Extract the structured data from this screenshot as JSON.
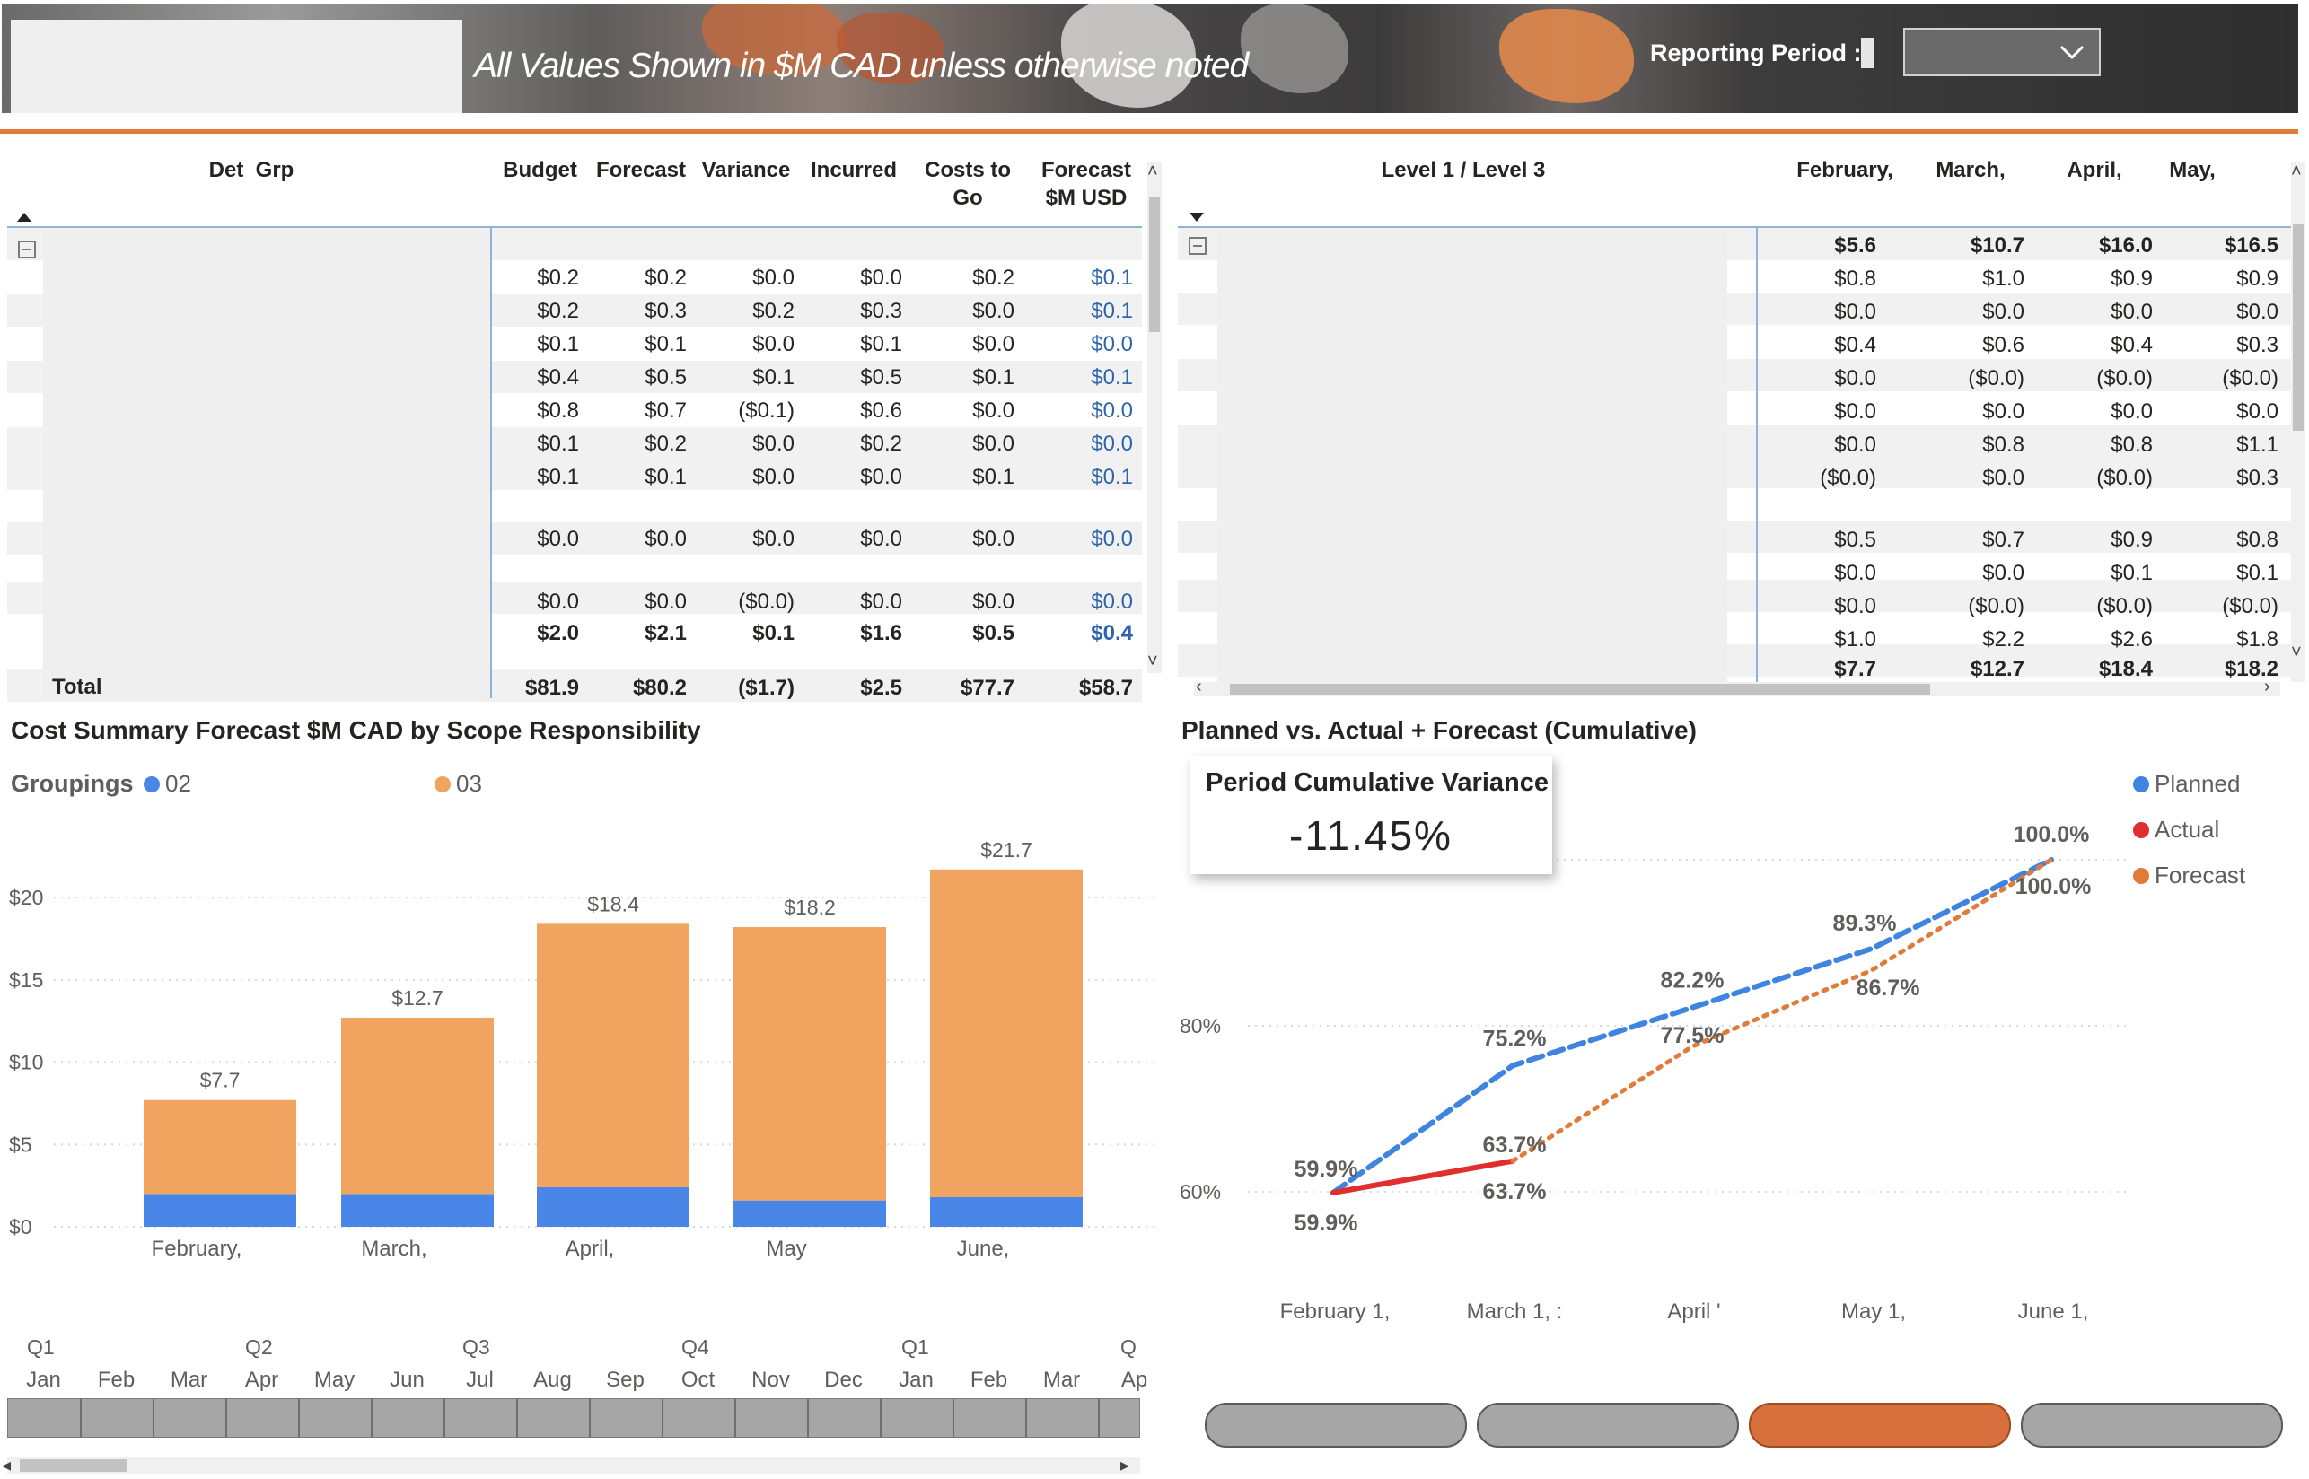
{
  "header": {
    "caption": "All Values Shown in $M CAD unless otherwise noted",
    "reporting_period_label": "Reporting Period :",
    "reporting_period_value": ""
  },
  "left_table": {
    "columns": [
      "Det_Grp",
      "Budget",
      "Forecast",
      "Variance",
      "Incurred",
      "Costs to Go",
      "Forecast $M USD"
    ],
    "rows": [
      [
        "$0.2",
        "$0.2",
        "$0.0",
        "$0.0",
        "$0.2",
        "$0.1"
      ],
      [
        "$0.2",
        "$0.3",
        "$0.2",
        "$0.3",
        "$0.0",
        "$0.1"
      ],
      [
        "$0.1",
        "$0.1",
        "$0.0",
        "$0.1",
        "$0.0",
        "$0.0"
      ],
      [
        "$0.4",
        "$0.5",
        "$0.1",
        "$0.5",
        "$0.1",
        "$0.1"
      ],
      [
        "$0.8",
        "$0.7",
        "($0.1)",
        "$0.6",
        "$0.0",
        "$0.0"
      ],
      [
        "$0.1",
        "$0.2",
        "$0.0",
        "$0.2",
        "$0.0",
        "$0.0"
      ],
      [
        "$0.1",
        "$0.1",
        "$0.0",
        "$0.0",
        "$0.1",
        "$0.1"
      ],
      [
        "$0.0",
        "$0.0",
        "$0.0",
        "$0.0",
        "$0.0",
        "$0.0"
      ],
      [
        "$0.0",
        "$0.0",
        "($0.0)",
        "$0.0",
        "$0.0",
        "$0.0"
      ]
    ],
    "subtotal": [
      "$2.0",
      "$2.1",
      "$0.1",
      "$1.6",
      "$0.5",
      "$0.4"
    ],
    "total_label": "Total",
    "total": [
      "$81.9",
      "$80.2",
      "($1.7)",
      "$2.5",
      "$77.7",
      "$58.7"
    ]
  },
  "right_table": {
    "columns": [
      "Level 1 / Level 3",
      "February,",
      "March,",
      "April,",
      "May,"
    ],
    "header_total": [
      "$5.6",
      "$10.7",
      "$16.0",
      "$16.5"
    ],
    "rows": [
      [
        "$0.8",
        "$1.0",
        "$0.9",
        "$0.9"
      ],
      [
        "$0.0",
        "$0.0",
        "$0.0",
        "$0.0"
      ],
      [
        "$0.4",
        "$0.6",
        "$0.4",
        "$0.3"
      ],
      [
        "$0.0",
        "($0.0)",
        "($0.0)",
        "($0.0)"
      ],
      [
        "$0.0",
        "$0.0",
        "$0.0",
        "$0.0"
      ],
      [
        "$0.0",
        "$0.8",
        "$0.8",
        "$1.1"
      ],
      [
        "($0.0)",
        "$0.0",
        "($0.0)",
        "$0.3"
      ],
      [
        "$0.5",
        "$0.7",
        "$0.9",
        "$0.8"
      ],
      [
        "$0.0",
        "$0.0",
        "$0.1",
        "$0.1"
      ],
      [
        "$0.0",
        "($0.0)",
        "($0.0)",
        "($0.0)"
      ],
      [
        "$1.0",
        "$2.2",
        "$2.6",
        "$1.8"
      ]
    ],
    "footer_total": [
      "$7.7",
      "$12.7",
      "$18.4",
      "$18.2"
    ]
  },
  "bar_chart_panel": {
    "title": "Cost Summary Forecast $M CAD by Scope Responsibility",
    "legend_title": "Groupings",
    "legend": [
      {
        "label": "02",
        "color": "#4a86e8"
      },
      {
        "label": "03",
        "color": "#f0a460"
      }
    ]
  },
  "line_chart_panel": {
    "title": "Planned vs. Actual + Forecast (Cumulative)",
    "legend": [
      {
        "label": "Planned",
        "color": "#3e84e0"
      },
      {
        "label": "Actual",
        "color": "#e02d2d"
      },
      {
        "label": "Forecast",
        "color": "#e07b39"
      }
    ]
  },
  "kpi": {
    "title": "Period Cumulative Variance",
    "value": "-11.45%"
  },
  "timeline": {
    "quarters": [
      "Q1",
      "Q2",
      "Q3",
      "Q4",
      "Q1",
      "Q"
    ],
    "months": [
      "Jan",
      "Feb",
      "Mar",
      "Apr",
      "May",
      "Jun",
      "Jul",
      "Aug",
      "Sep",
      "Oct",
      "Nov",
      "Dec",
      "Jan",
      "Feb",
      "Mar",
      "Ap"
    ]
  },
  "nav_buttons": [
    {
      "label": "",
      "active": false
    },
    {
      "label": "",
      "active": false
    },
    {
      "label": "",
      "active": true
    },
    {
      "label": "",
      "active": false
    }
  ],
  "chart_data": [
    {
      "type": "bar",
      "stacked": true,
      "categories": [
        "February,",
        "March,",
        "April,",
        "May",
        "June,"
      ],
      "series": [
        {
          "name": "02",
          "values": [
            2.0,
            2.0,
            2.4,
            1.6,
            1.8
          ]
        },
        {
          "name": "03",
          "values": [
            5.7,
            10.7,
            16.0,
            16.6,
            19.9
          ]
        }
      ],
      "totals": [
        7.7,
        12.7,
        18.4,
        18.2,
        21.7
      ],
      "data_labels": [
        "$7.7",
        "$12.7",
        "$18.4",
        "$18.2",
        "$21.7"
      ],
      "y_ticks": [
        "$0",
        "$5",
        "$10",
        "$15",
        "$20"
      ],
      "ylim": [
        0,
        22
      ],
      "grid": true
    },
    {
      "type": "line",
      "x": [
        "February 1,",
        "March 1, :",
        "April '",
        "May 1,",
        "June 1,"
      ],
      "series": [
        {
          "name": "Planned",
          "values": [
            59.9,
            75.2,
            82.2,
            89.3,
            100.0
          ],
          "labels": [
            "59.9%",
            "75.2%",
            "82.2%",
            "89.3%",
            "100.0%"
          ]
        },
        {
          "name": "Actual",
          "values": [
            59.9,
            63.7
          ],
          "labels": [
            "59.9%",
            "63.7%"
          ]
        },
        {
          "name": "Forecast",
          "values": [
            null,
            63.7,
            77.5,
            86.7,
            100.0
          ],
          "labels": [
            "",
            "63.7%",
            "77.5%",
            "86.7%",
            "100.0%"
          ]
        }
      ],
      "y_ticks": [
        "60%",
        "80%"
      ],
      "ylim": [
        57,
        104
      ],
      "grid": true,
      "legend_position": "top-right"
    }
  ]
}
